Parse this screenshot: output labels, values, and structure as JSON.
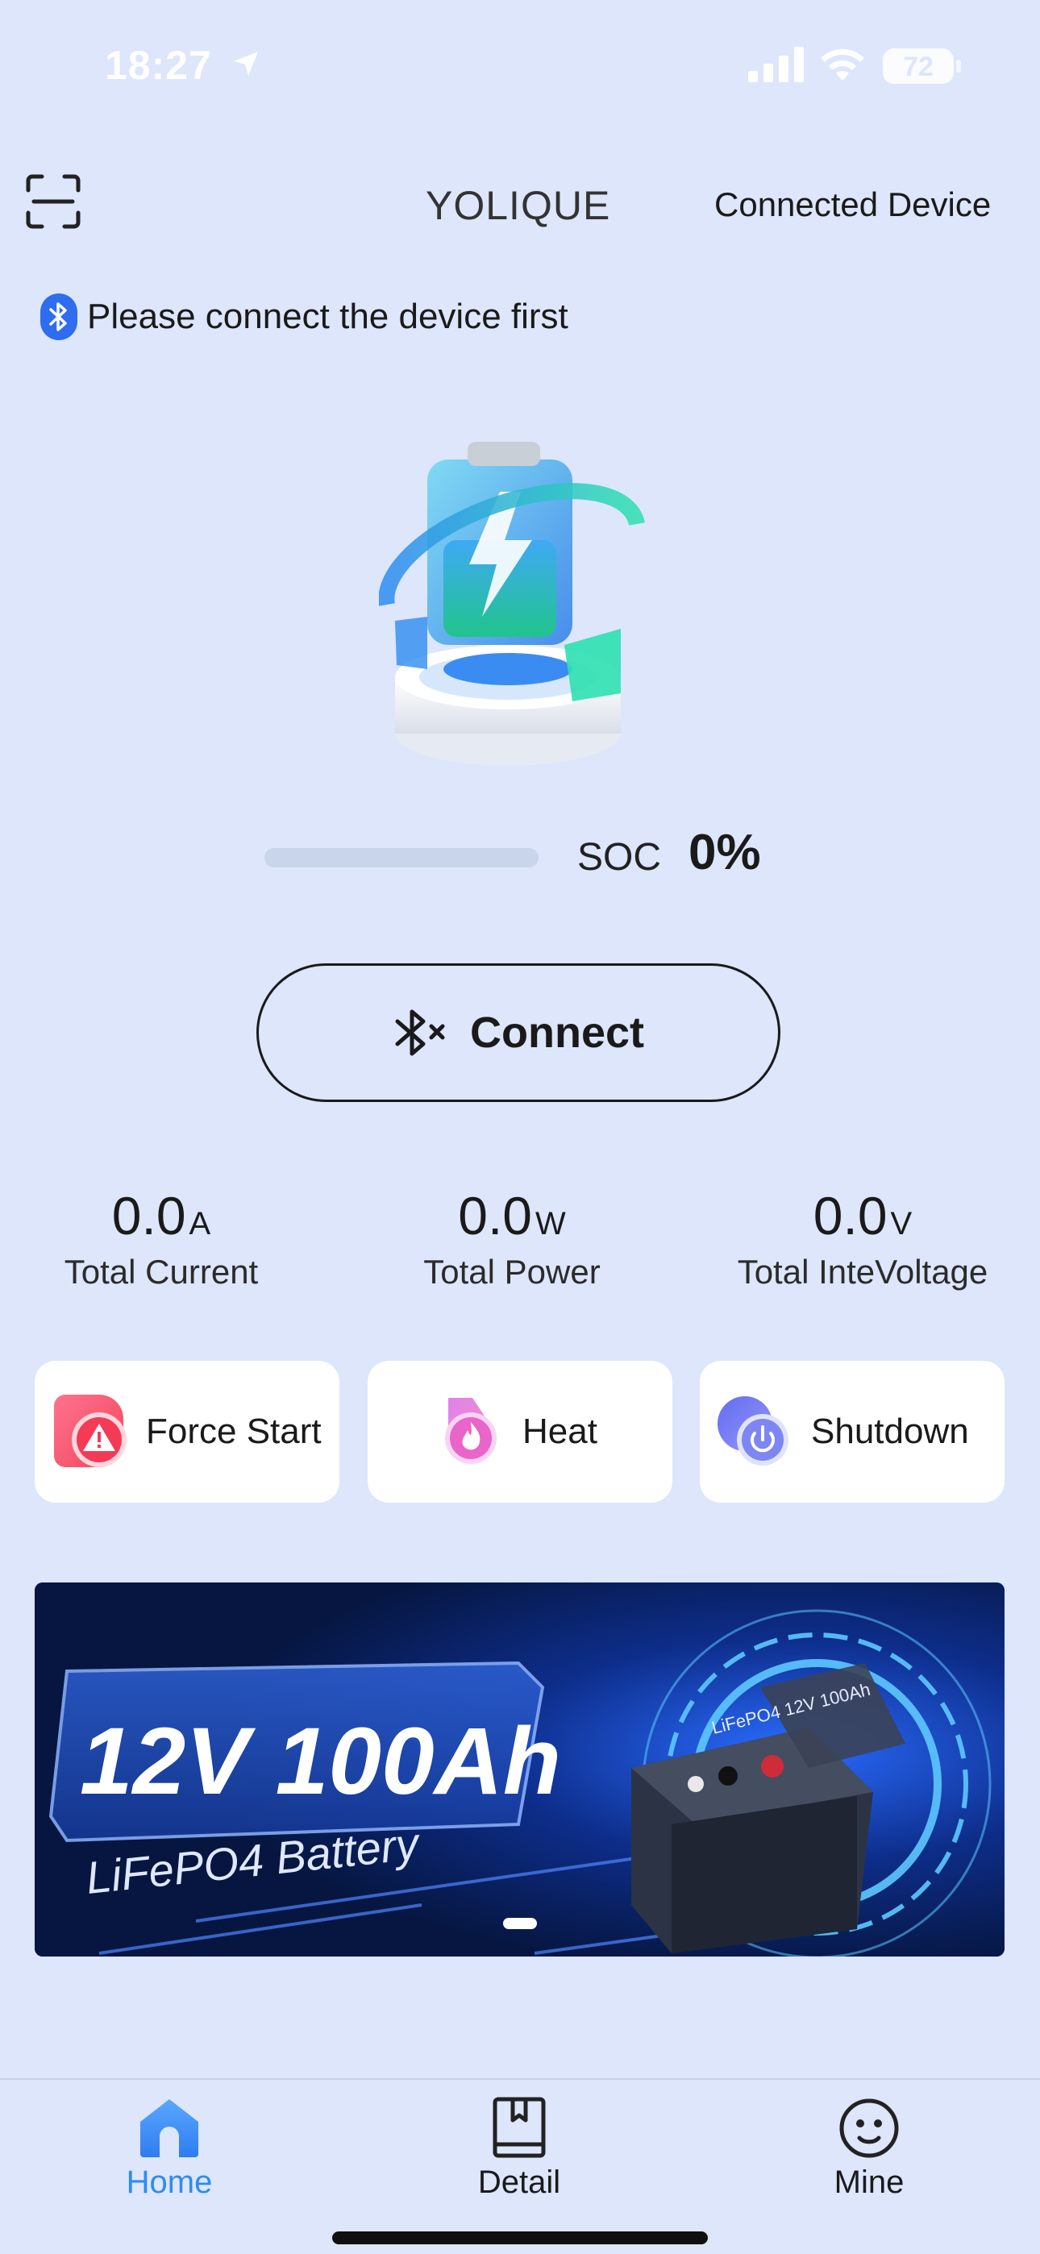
{
  "status_bar": {
    "time": "18:27",
    "battery_level": "72"
  },
  "header": {
    "title": "YOLIQUE",
    "connected_device_label": "Connected Device"
  },
  "notice": {
    "text": "Please connect the device first"
  },
  "soc": {
    "label": "SOC",
    "value": "0%",
    "fraction": 0
  },
  "connect_button": {
    "label": "Connect"
  },
  "metrics": [
    {
      "value": "0.0",
      "unit": "A",
      "label": "Total Current"
    },
    {
      "value": "0.0",
      "unit": "W",
      "label": "Total Power"
    },
    {
      "value": "0.0",
      "unit": "V",
      "label": "Total InteVoltage"
    }
  ],
  "actions": [
    {
      "label": "Force Start",
      "icon": "warning-icon"
    },
    {
      "label": "Heat",
      "icon": "flame-icon"
    },
    {
      "label": "Shutdown",
      "icon": "power-icon"
    }
  ],
  "banner": {
    "headline": "12V 100Ah",
    "subline": "LiFePO4 Battery",
    "product_label": "LiFePO4 12V 100Ah"
  },
  "tabs": [
    {
      "label": "Home",
      "icon": "home-icon",
      "active": true
    },
    {
      "label": "Detail",
      "icon": "book-icon",
      "active": false
    },
    {
      "label": "Mine",
      "icon": "smiley-icon",
      "active": false
    }
  ],
  "colors": {
    "background": "#dde6fb",
    "accent": "#2f8cf0",
    "bluetooth": "#2e6cf0"
  }
}
